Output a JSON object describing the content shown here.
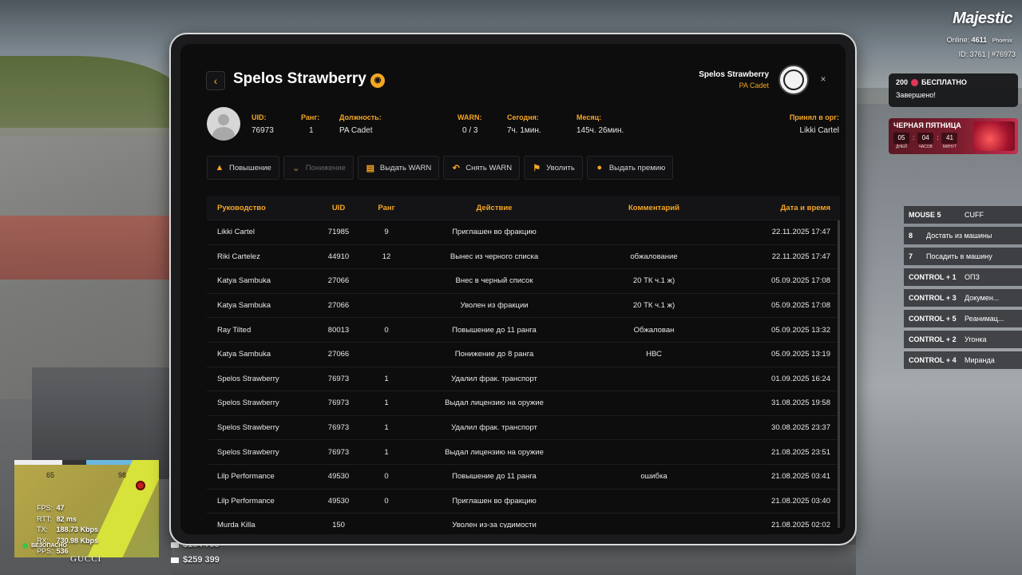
{
  "hud": {
    "logo": "Majestic",
    "online_label": "Online:",
    "online_value": "4611",
    "server": "Phoenix",
    "id_line": "ID: 3761 | #76973",
    "notification": {
      "amount": "200",
      "label": "БЕСПЛАТНО",
      "status": "Завершено!"
    },
    "promo": {
      "title": "ЧЕРНАЯ ПЯТНИЦА",
      "days": "05",
      "hours": "04",
      "minutes": "41",
      "days_label": "ДНЕЙ",
      "hours_label": "ЧАСОВ",
      "minutes_label": "МИНУТ"
    },
    "binds": [
      {
        "key": "MOUSE 5",
        "label": "CUFF"
      },
      {
        "key": "8",
        "label": "Достать из машины"
      },
      {
        "key": "7",
        "label": "Посадить в машину"
      },
      {
        "key": "CONTROL + 1",
        "label": "ОПЗ"
      },
      {
        "key": "CONTROL + 3",
        "label": "Докумен..."
      },
      {
        "key": "CONTROL + 5",
        "label": "Реанимац..."
      },
      {
        "key": "CONTROL + 2",
        "label": "Угонка"
      },
      {
        "key": "CONTROL + 4",
        "label": "Миранда"
      }
    ],
    "minimap": {
      "num_left": "65",
      "num_right": "98"
    },
    "stats": {
      "fps_label": "FPS:",
      "fps": "47",
      "rtt_label": "RTT:",
      "rtt": "82 ms",
      "tx_label": "TX:",
      "tx": "188.73 Kbps",
      "rx_label": "RX:",
      "rx": "730.98 Kbps",
      "pps_label": "PPS:",
      "pps": "536"
    },
    "safe_label": "БЕЗОПАСНО",
    "brand": "GUCCI",
    "money_cash": "$184 799",
    "money_bank": "$259 399"
  },
  "tablet": {
    "back_icon": "chevron-left-icon",
    "player_name": "Spelos Strawberry",
    "org_user_name": "Spelos Strawberry",
    "org_user_rank": "PA Cadet",
    "close_glyph": "×",
    "info": {
      "uid_label": "UID:",
      "uid": "76973",
      "rank_label": "Ранг:",
      "rank": "1",
      "position_label": "Должность:",
      "position": "PA Cadet",
      "warn_label": "WARN:",
      "warn": "0 / 3",
      "today_label": "Сегодня:",
      "today": "7ч. 1мин.",
      "month_label": "Месяц:",
      "month": "145ч. 26мин.",
      "accepted_label": "Принял в орг:",
      "accepted": "Likki Cartel"
    },
    "actions": [
      {
        "label": "Повышение",
        "icon": "arrow-up-icon",
        "disabled": false
      },
      {
        "label": "Понижение",
        "icon": "arrow-down-icon",
        "disabled": true
      },
      {
        "label": "Выдать WARN",
        "icon": "warn-doc-icon",
        "disabled": false
      },
      {
        "label": "Снять WARN",
        "icon": "undo-icon",
        "disabled": false
      },
      {
        "label": "Уволить",
        "icon": "fire-person-icon",
        "disabled": false
      },
      {
        "label": "Выдать премию",
        "icon": "coin-icon",
        "disabled": false
      }
    ],
    "table": {
      "headers": [
        "Руководство",
        "UID",
        "Ранг",
        "Действие",
        "Комментарий",
        "Дата и время"
      ],
      "rows": [
        [
          "Likki Cartel",
          "71985",
          "9",
          "Приглашен во фракцию",
          "",
          "22.11.2025 17:47"
        ],
        [
          "Riki Cartelez",
          "44910",
          "12",
          "Вынес из черного списка",
          "обжалование",
          "22.11.2025 17:47"
        ],
        [
          "Katya Sambuka",
          "27066",
          "",
          "Внес в черный список",
          "20 ТК ч.1 ж)",
          "05.09.2025 17:08"
        ],
        [
          "Katya Sambuka",
          "27066",
          "",
          "Уволен из фракции",
          "20 ТК ч.1 ж)",
          "05.09.2025 17:08"
        ],
        [
          "Ray Tilted",
          "80013",
          "0",
          "Повышение до 11 ранга",
          "Обжалован",
          "05.09.2025 13:32"
        ],
        [
          "Katya Sambuka",
          "27066",
          "",
          "Понижение до 8 ранга",
          "НВС",
          "05.09.2025 13:19"
        ],
        [
          "Spelos Strawberry",
          "76973",
          "1",
          "Удалил фрак. транспорт",
          "",
          "01.09.2025 16:24"
        ],
        [
          "Spelos Strawberry",
          "76973",
          "1",
          "Выдал лицензию на оружие",
          "",
          "31.08.2025 19:58"
        ],
        [
          "Spelos Strawberry",
          "76973",
          "1",
          "Удалил фрак. транспорт",
          "",
          "30.08.2025 23:37"
        ],
        [
          "Spelos Strawberry",
          "76973",
          "1",
          "Выдал лицензию на оружие",
          "",
          "21.08.2025 23:51"
        ],
        [
          "Lilp Performance",
          "49530",
          "0",
          "Повышение до 11 ранга",
          "ошибка",
          "21.08.2025 03:41"
        ],
        [
          "Lilp Performance",
          "49530",
          "0",
          "Приглашен во фракцию",
          "",
          "21.08.2025 03:40"
        ],
        [
          "Murda Killa",
          "150",
          "",
          "Уволен из-за судимости",
          "",
          "21.08.2025 02:02"
        ]
      ]
    }
  }
}
